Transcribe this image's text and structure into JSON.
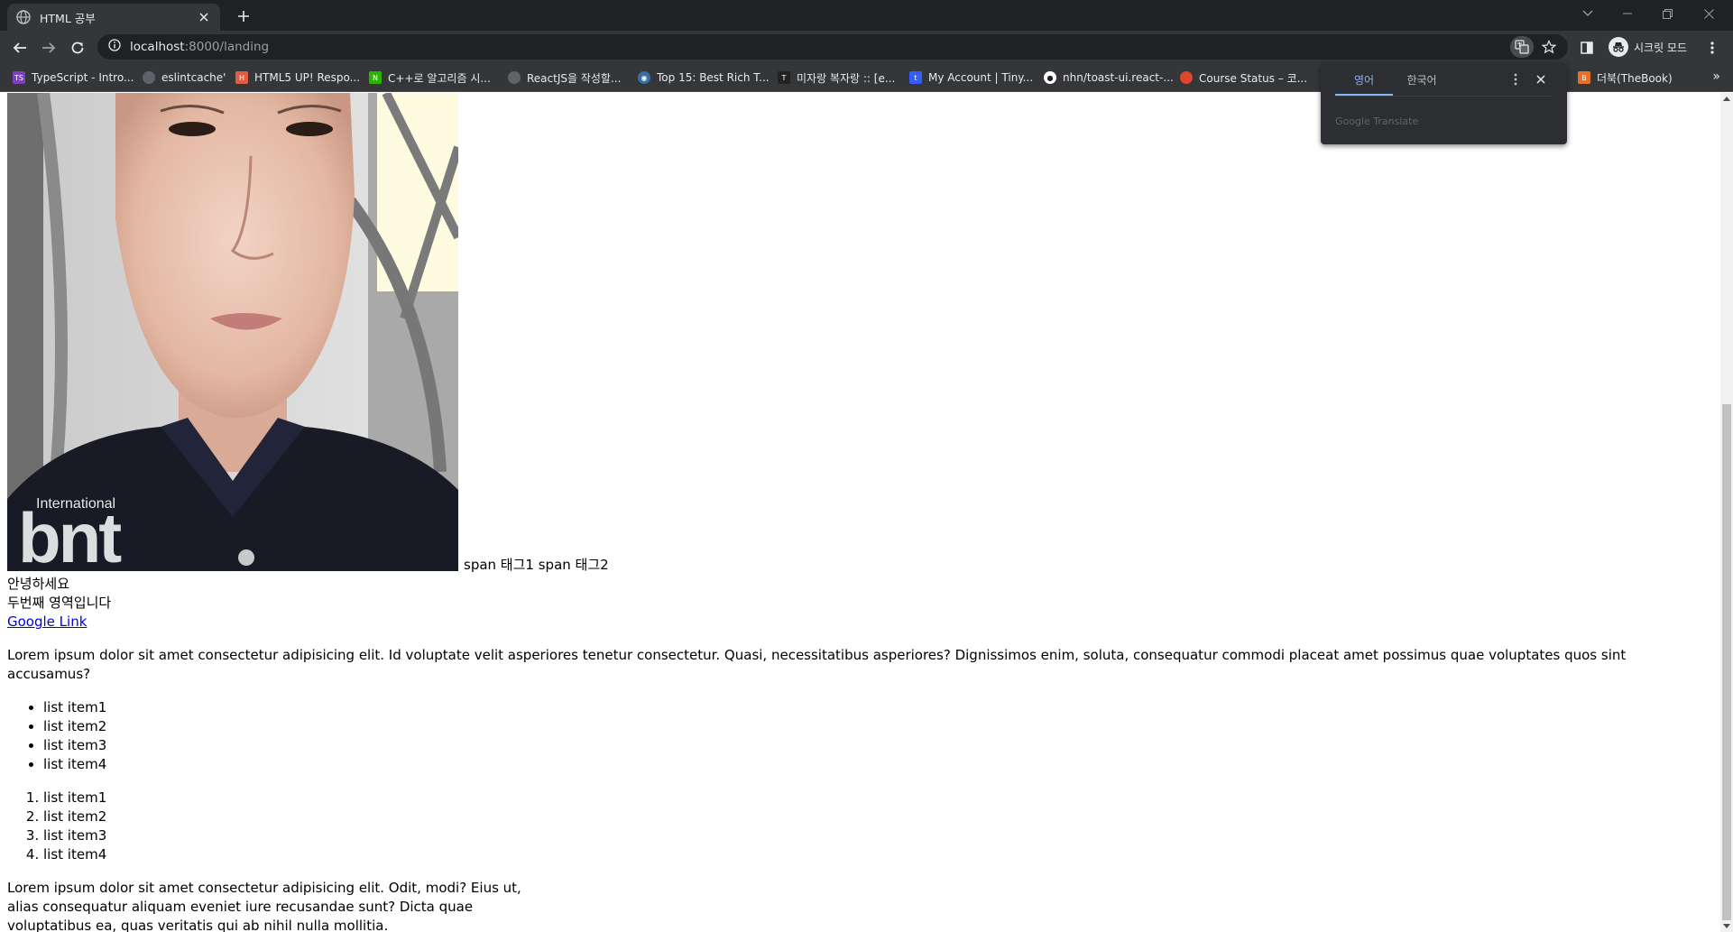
{
  "browser": {
    "tab_title": "HTML 공부",
    "url_host": "localhost",
    "url_path": ":8000/landing",
    "profile_label": "시크릿 모드"
  },
  "bookmarks": [
    {
      "label": "TypeScript - Intro...",
      "icon": "typescript-icon",
      "color": "#7b3fbf"
    },
    {
      "label": "eslintcache'",
      "icon": "globe-icon",
      "color": "#5f6368"
    },
    {
      "label": "HTML5 UP! Respo...",
      "icon": "html5up-icon",
      "color": "#e05d44"
    },
    {
      "label": "C++로 알고리즘 시...",
      "icon": "naver-icon",
      "color": "#2db400"
    },
    {
      "label": "ReactJS을 작성할...",
      "icon": "globe-icon",
      "color": "#5f6368"
    },
    {
      "label": "Top 15: Best Rich T...",
      "icon": "eye-icon",
      "color": "#3a6ea5"
    },
    {
      "label": "미자랑 복자랑 :: [e...",
      "icon": "tistory-icon",
      "color": "#222222"
    },
    {
      "label": "My Account | Tiny...",
      "icon": "tiny-icon",
      "color": "#335dff"
    },
    {
      "label": "nhn/toast-ui.react-...",
      "icon": "github-icon",
      "color": "#ffffff"
    },
    {
      "label": "Course Status – 코...",
      "icon": "apple-icon",
      "color": "#e0462c"
    },
    {
      "label": "더북(TheBook)",
      "icon": "thebook-icon",
      "color": "#e8702a"
    }
  ],
  "translate_popup": {
    "tab_source": "영어",
    "tab_target": "한국어",
    "brand": "Google Translate"
  },
  "page": {
    "photo_watermark_small": "International",
    "photo_watermark_big": "bnt",
    "span1": "span 태그1",
    "span2": "span 태그2",
    "div1": "안녕하세요",
    "div2": "두번째 영역입니다",
    "link": "Google Link",
    "para1": "Lorem ipsum dolor sit amet consectetur adipisicing elit. Id voluptate velit asperiores tenetur consectetur. Quasi, necessitatibus asperiores? Dignissimos enim, soluta, consequatur commodi placeat amet possimus quae voluptates quos sint accusamus?",
    "ul_items": [
      "list item1",
      "list item2",
      "list item3",
      "list item4"
    ],
    "ol_items": [
      "list item1",
      "list item2",
      "list item3",
      "list item4"
    ],
    "para2_lines": [
      "Lorem ipsum dolor sit amet consectetur adipisicing elit. Odit, modi? Eius ut,",
      "alias consequatur aliquam eveniet iure recusandae sunt? Dicta quae",
      "voluptatibus ea, quas veritatis qui ab nihil nulla mollitia."
    ]
  }
}
